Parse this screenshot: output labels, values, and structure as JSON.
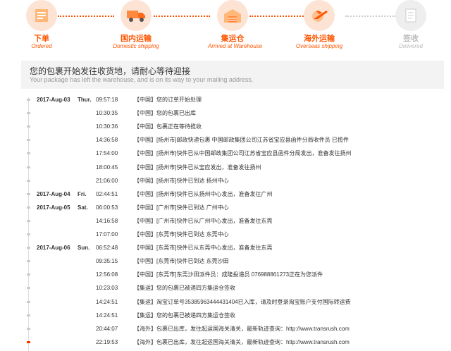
{
  "steps": [
    {
      "cn": "下单",
      "en": "Ordered",
      "icon": "order-form-icon",
      "state": "active"
    },
    {
      "cn": "国内运输",
      "en": "Domestic shipping",
      "icon": "delivery-truck-icon",
      "state": "active"
    },
    {
      "cn": "集运仓",
      "en": "Arrived at Warehouse",
      "icon": "warehouse-icon",
      "state": "active"
    },
    {
      "cn": "海外运输",
      "en": "Overseas shipping",
      "icon": "airplane-icon",
      "state": "active"
    },
    {
      "cn": "签收",
      "en": "Delivered",
      "icon": "signed-document-icon",
      "state": "inactive"
    }
  ],
  "colors": {
    "accent": "#ff5500",
    "inactive": "#bbbbbb",
    "current_dot": "#ff3300"
  },
  "status": {
    "cn": "您的包裹开始发往收货地，请耐心等待迎接",
    "en": "Your package has left the warehouse, and is on its way to your mailing address."
  },
  "events": [
    {
      "date": "2017-Aug-03",
      "weekday": "Thur.",
      "time": "09:57:18",
      "desc": "【中国】您的订单开始处理"
    },
    {
      "date": "",
      "weekday": "",
      "time": "10:30:35",
      "desc": "【中国】您的包裹已出库"
    },
    {
      "date": "",
      "weekday": "",
      "time": "10:30:36",
      "desc": "【中国】包裹正在等待揽收"
    },
    {
      "date": "",
      "weekday": "",
      "time": "14:36:58",
      "desc": "【中国】[扬州市]邮政快递包裹 中国邮政集团公司江苏省宝应县函件分局收件员 已揽件"
    },
    {
      "date": "",
      "weekday": "",
      "time": "17:54:00",
      "desc": "【中国】[扬州市]快件已从中国邮政集团公司江苏省宝应县函件分局发出，准备发往扬州"
    },
    {
      "date": "",
      "weekday": "",
      "time": "18:00:45",
      "desc": "【中国】[扬州市]快件已从宝应发出，准备发往扬州"
    },
    {
      "date": "",
      "weekday": "",
      "time": "21:06:00",
      "desc": "【中国】[扬州市]快件已到达 扬州中心"
    },
    {
      "date": "2017-Aug-04",
      "weekday": "Fri.",
      "time": "02:44:51",
      "desc": "【中国】[扬州市]快件已从扬州中心发出，准备发往广州"
    },
    {
      "date": "2017-Aug-05",
      "weekday": "Sat.",
      "time": "06:00:53",
      "desc": "【中国】[广州市]快件已到达 广州中心"
    },
    {
      "date": "",
      "weekday": "",
      "time": "14:16:58",
      "desc": "【中国】[广州市]快件已从广州中心发出，准备发往东莞"
    },
    {
      "date": "",
      "weekday": "",
      "time": "17:07:00",
      "desc": "【中国】[东莞市]快件已到达 东莞中心"
    },
    {
      "date": "2017-Aug-06",
      "weekday": "Sun.",
      "time": "06:52:48",
      "desc": "【中国】[东莞市]快件已从东莞中心发出，准备发往东莞"
    },
    {
      "date": "",
      "weekday": "",
      "time": "09:35:15",
      "desc": "【中国】[东莞市]快件已到达 东莞沙田"
    },
    {
      "date": "",
      "weekday": "",
      "time": "12:56:08",
      "desc": "【中国】[东莞市]东莞沙田派件员：成隆投递员 076988861273正在为您派件"
    },
    {
      "date": "",
      "weekday": "",
      "time": "10:23:03",
      "desc": "【集运】您的包裹已被递四方集运仓签收"
    },
    {
      "date": "",
      "weekday": "",
      "time": "14:24:51",
      "desc": "【集运】淘宝订单号35385963444431404已入库，请及时登录淘宝账户支付国际转运费"
    },
    {
      "date": "",
      "weekday": "",
      "time": "14:24:51",
      "desc": "【集运】您的包裹已被递四方集运仓签收"
    },
    {
      "date": "",
      "weekday": "",
      "time": "20:44:07",
      "desc": "【海外】包裹已出库，发往起运国海关清关，最新轨迹查询：http://www.transrush.com"
    },
    {
      "date": "",
      "weekday": "",
      "time": "22:19:53",
      "desc": "【海外】包裹已出库，发往起运国海关清关，最新轨迹查询：http://www.transrush.com",
      "current": true
    }
  ]
}
